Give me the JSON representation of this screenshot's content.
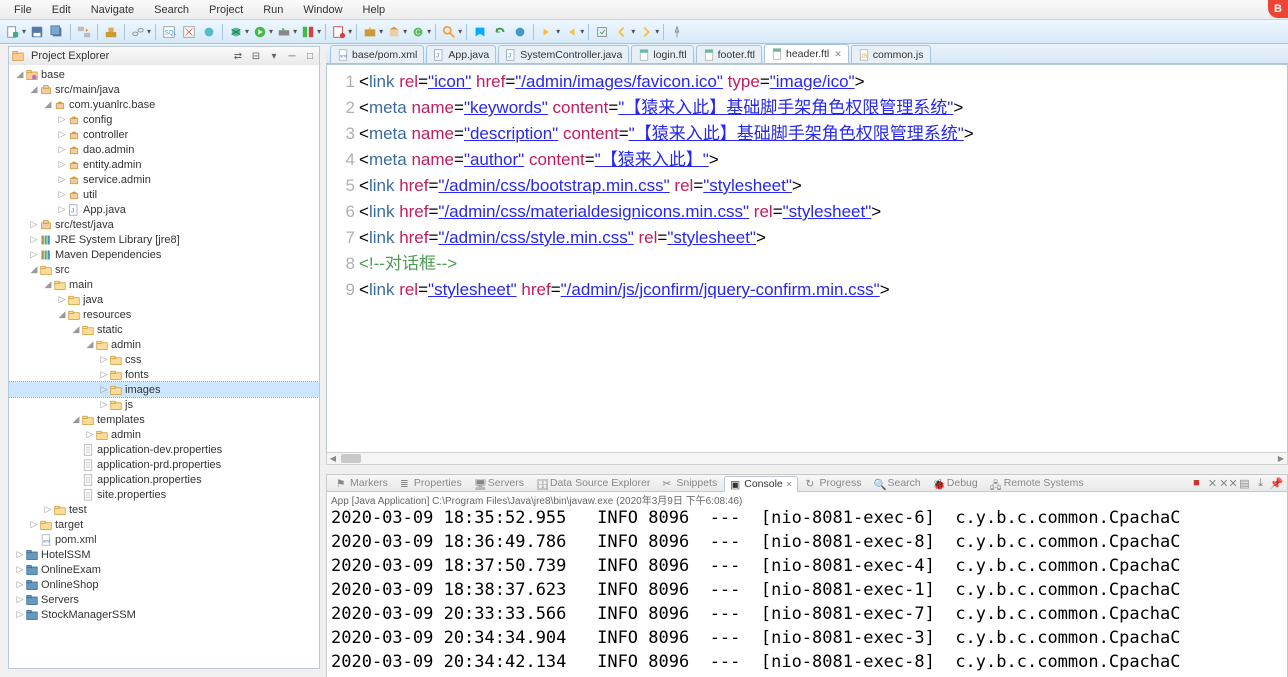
{
  "menu": [
    "File",
    "Edit",
    "Navigate",
    "Search",
    "Project",
    "Run",
    "Window",
    "Help"
  ],
  "explorer": {
    "title": "Project Explorer",
    "tree": [
      {
        "d": 0,
        "t": "tri-open",
        "i": "proj",
        "l": "base"
      },
      {
        "d": 1,
        "t": "tri-open",
        "i": "pkg-root",
        "l": "src/main/java"
      },
      {
        "d": 2,
        "t": "tri-open",
        "i": "pkg",
        "l": "com.yuanlrc.base"
      },
      {
        "d": 3,
        "t": "tri",
        "i": "pkg",
        "l": "config"
      },
      {
        "d": 3,
        "t": "tri",
        "i": "pkg",
        "l": "controller"
      },
      {
        "d": 3,
        "t": "tri",
        "i": "pkg",
        "l": "dao.admin"
      },
      {
        "d": 3,
        "t": "tri",
        "i": "pkg",
        "l": "entity.admin"
      },
      {
        "d": 3,
        "t": "tri",
        "i": "pkg",
        "l": "service.admin"
      },
      {
        "d": 3,
        "t": "tri",
        "i": "pkg",
        "l": "util"
      },
      {
        "d": 3,
        "t": "tri",
        "i": "java",
        "l": "App.java"
      },
      {
        "d": 1,
        "t": "tri",
        "i": "pkg-root",
        "l": "src/test/java"
      },
      {
        "d": 1,
        "t": "tri",
        "i": "lib",
        "l": "JRE System Library [jre8]"
      },
      {
        "d": 1,
        "t": "tri",
        "i": "lib",
        "l": "Maven Dependencies"
      },
      {
        "d": 1,
        "t": "tri-open",
        "i": "folder",
        "l": "src"
      },
      {
        "d": 2,
        "t": "tri-open",
        "i": "folder",
        "l": "main"
      },
      {
        "d": 3,
        "t": "tri",
        "i": "folder",
        "l": "java"
      },
      {
        "d": 3,
        "t": "tri-open",
        "i": "folder",
        "l": "resources"
      },
      {
        "d": 4,
        "t": "tri-open",
        "i": "folder",
        "l": "static"
      },
      {
        "d": 5,
        "t": "tri-open",
        "i": "folder",
        "l": "admin"
      },
      {
        "d": 6,
        "t": "tri",
        "i": "folder",
        "l": "css"
      },
      {
        "d": 6,
        "t": "tri",
        "i": "folder",
        "l": "fonts"
      },
      {
        "d": 6,
        "t": "tri",
        "i": "folder",
        "l": "images",
        "sel": true
      },
      {
        "d": 6,
        "t": "tri",
        "i": "folder",
        "l": "js"
      },
      {
        "d": 4,
        "t": "tri-open",
        "i": "folder",
        "l": "templates"
      },
      {
        "d": 5,
        "t": "tri",
        "i": "folder",
        "l": "admin"
      },
      {
        "d": 4,
        "t": "none",
        "i": "file",
        "l": "application-dev.properties"
      },
      {
        "d": 4,
        "t": "none",
        "i": "file",
        "l": "application-prd.properties"
      },
      {
        "d": 4,
        "t": "none",
        "i": "file",
        "l": "application.properties"
      },
      {
        "d": 4,
        "t": "none",
        "i": "file",
        "l": "site.properties"
      },
      {
        "d": 2,
        "t": "tri",
        "i": "folder",
        "l": "test"
      },
      {
        "d": 1,
        "t": "tri",
        "i": "folder",
        "l": "target"
      },
      {
        "d": 1,
        "t": "none",
        "i": "xml",
        "l": "pom.xml"
      },
      {
        "d": 0,
        "t": "tri",
        "i": "proj-closed",
        "l": "HotelSSM"
      },
      {
        "d": 0,
        "t": "tri",
        "i": "proj-closed",
        "l": "OnlineExam"
      },
      {
        "d": 0,
        "t": "tri",
        "i": "proj-closed",
        "l": "OnlineShop"
      },
      {
        "d": 0,
        "t": "tri",
        "i": "proj-closed",
        "l": "Servers"
      },
      {
        "d": 0,
        "t": "tri",
        "i": "proj-closed",
        "l": "StockManagerSSM"
      }
    ]
  },
  "tabs": [
    {
      "i": "xml",
      "l": "base/pom.xml"
    },
    {
      "i": "java",
      "l": "App.java"
    },
    {
      "i": "java",
      "l": "SystemController.java"
    },
    {
      "i": "ftl",
      "l": "login.ftl"
    },
    {
      "i": "ftl",
      "l": "footer.ftl"
    },
    {
      "i": "ftl",
      "l": "header.ftl",
      "active": true,
      "close": true
    },
    {
      "i": "js",
      "l": "common.js"
    }
  ],
  "code": {
    "lines": [
      {
        "n": 1,
        "html": "<span class='txt'>&lt;</span><span class='tag'>link</span> <span class='attr'>rel</span>=<span class='val'>\"icon\"</span> <span class='attr'>href</span>=<span class='val'>\"/admin/images/favicon.ico\"</span> <span class='attr'>type</span>=<span class='val'>\"image/ico\"</span><span class='txt'>&gt;</span>"
      },
      {
        "n": 2,
        "html": "<span class='txt'>&lt;</span><span class='tag'>meta</span> <span class='attr'>name</span>=<span class='val'>\"keywords\"</span> <span class='attr'>content</span>=<span class='val'>\"【猿来入此】基础脚手架角色权限管理系统\"</span><span class='txt'>&gt;</span>"
      },
      {
        "n": 3,
        "html": "<span class='txt'>&lt;</span><span class='tag'>meta</span> <span class='attr'>name</span>=<span class='val'>\"description\"</span> <span class='attr'>content</span>=<span class='val'>\"【猿来入此】基础脚手架角色权限管理系统\"</span><span class='txt'>&gt;</span>"
      },
      {
        "n": 4,
        "html": "<span class='txt'>&lt;</span><span class='tag'>meta</span> <span class='attr'>name</span>=<span class='val'>\"author\"</span> <span class='attr'>content</span>=<span class='val'>\"【猿来入此】\"</span><span class='txt'>&gt;</span>"
      },
      {
        "n": 5,
        "html": "<span class='txt'>&lt;</span><span class='tag'>link</span> <span class='attr'>href</span>=<span class='val'>\"/admin/css/bootstrap.min.css\"</span> <span class='attr'>rel</span>=<span class='val'>\"stylesheet\"</span><span class='txt'>&gt;</span>"
      },
      {
        "n": 6,
        "html": "<span class='txt'>&lt;</span><span class='tag'>link</span> <span class='attr'>href</span>=<span class='val'>\"/admin/css/materialdesignicons.min.css\"</span> <span class='attr'>rel</span>=<span class='val'>\"stylesheet\"</span><span class='txt'>&gt;</span>"
      },
      {
        "n": 7,
        "html": "<span class='txt'>&lt;</span><span class='tag'>link</span> <span class='attr'>href</span>=<span class='val'>\"/admin/css/style.min.css\"</span> <span class='attr'>rel</span>=<span class='val'>\"stylesheet\"</span><span class='txt'>&gt;</span>"
      },
      {
        "n": 8,
        "html": "<span class='cmt'>&lt;!--对话框--&gt;</span>"
      },
      {
        "n": 9,
        "html": "<span class='txt'>&lt;</span><span class='tag'>link</span> <span class='attr'>rel</span>=<span class='val'>\"stylesheet\"</span> <span class='attr'>href</span>=<span class='val'>\"/admin/js/jconfirm/jquery-confirm.min.css\"</span><span class='txt'>&gt;</span>"
      }
    ]
  },
  "console": {
    "tabs": [
      "Markers",
      "Properties",
      "Servers",
      "Data Source Explorer",
      "Snippets",
      "Console",
      "Progress",
      "Search",
      "Debug",
      "Remote Systems"
    ],
    "activeTab": "Console",
    "header": "App [Java Application] C:\\Program Files\\Java\\jre8\\bin\\javaw.exe (2020年3月9日 下午6:08:46)",
    "lines": [
      "2020-03-09 18:35:52.955   INFO 8096  ---  [nio-8081-exec-6]  c.y.b.c.common.CpachaC",
      "2020-03-09 18:36:49.786   INFO 8096  ---  [nio-8081-exec-8]  c.y.b.c.common.CpachaC",
      "2020-03-09 18:37:50.739   INFO 8096  ---  [nio-8081-exec-4]  c.y.b.c.common.CpachaC",
      "2020-03-09 18:38:37.623   INFO 8096  ---  [nio-8081-exec-1]  c.y.b.c.common.CpachaC",
      "2020-03-09 20:33:33.566   INFO 8096  ---  [nio-8081-exec-7]  c.y.b.c.common.CpachaC",
      "2020-03-09 20:34:34.904   INFO 8096  ---  [nio-8081-exec-3]  c.y.b.c.common.CpachaC",
      "2020-03-09 20:34:42.134   INFO 8096  ---  [nio-8081-exec-8]  c.y.b.c.common.CpachaC"
    ]
  }
}
